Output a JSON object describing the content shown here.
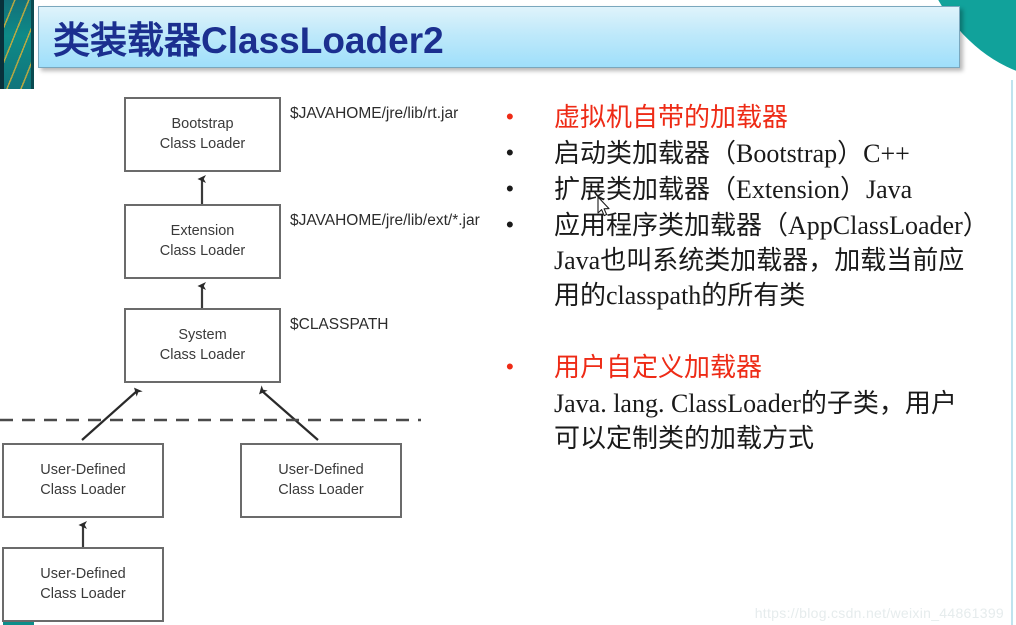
{
  "slide": {
    "title": "类装载器ClassLoader2",
    "watermark": "https://blog.csdn.net/weixin_44861399"
  },
  "colors": {
    "title_text": "#1b2f8f",
    "title_bg_top": "#dff3fb",
    "title_bg_bottom": "#9fdffb",
    "accent_teal": "#11a29b",
    "bullet_red": "#ee2b16",
    "body_text": "#1a1a1a",
    "node_border": "#6b6b6b"
  },
  "diagram": {
    "nodes": [
      {
        "id": "bootstrap",
        "line1": "Bootstrap",
        "line2": "Class Loader"
      },
      {
        "id": "extension",
        "line1": "Extension",
        "line2": "Class Loader"
      },
      {
        "id": "system",
        "line1": "System",
        "line2": "Class Loader"
      },
      {
        "id": "user-defined-left",
        "line1": "User-Defined",
        "line2": "Class Loader"
      },
      {
        "id": "user-defined-right",
        "line1": "User-Defined",
        "line2": "Class Loader"
      },
      {
        "id": "user-defined-bottom",
        "line1": "User-Defined",
        "line2": "Class Loader"
      }
    ],
    "path_labels": [
      {
        "id": "rt-jar",
        "text": "$JAVAHOME/jre/lib/rt.jar"
      },
      {
        "id": "ext-jar",
        "text": "$JAVAHOME/jre/lib/ext/*.jar"
      },
      {
        "id": "classpath",
        "text": "$CLASSPATH"
      }
    ]
  },
  "content": {
    "groups": [
      {
        "id": "builtin-loaders",
        "bullet_color": "red",
        "heading": "虚拟机自带的加载器",
        "items": [
          {
            "bullet_color": "dark",
            "lines": [
              "启动类加载器（Bootstrap）C++"
            ]
          },
          {
            "bullet_color": "dark",
            "lines": [
              "扩展类加载器（Extension）Java"
            ]
          },
          {
            "bullet_color": "dark",
            "lines": [
              "应用程序类加载器（AppClassLoader）",
              "Java也叫系统类加载器，加载当前应",
              "用的classpath的所有类"
            ]
          }
        ]
      },
      {
        "id": "user-defined-loaders",
        "bullet_color": "red",
        "heading": "用户自定义加载器",
        "items": [
          {
            "bullet_color": "none",
            "lines": [
              "Java. lang. ClassLoader的子类，用户",
              "可以定制类的加载方式"
            ]
          }
        ]
      }
    ]
  }
}
